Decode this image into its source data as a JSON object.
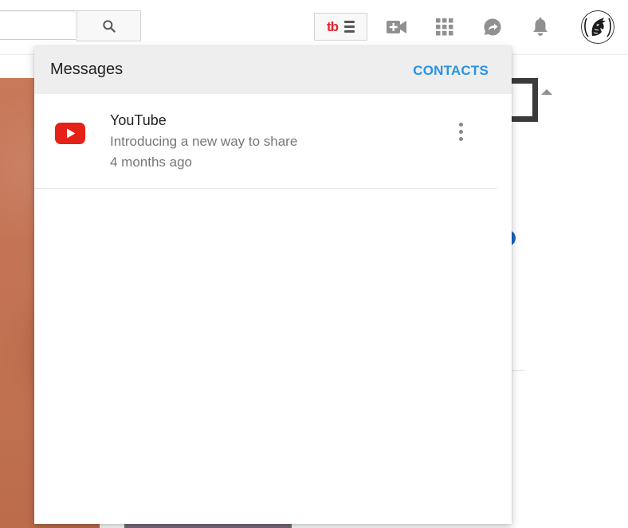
{
  "search": {
    "value": "",
    "placeholder": ""
  },
  "toolbar": {
    "extension_logo_text": "tb",
    "icons": [
      "search-icon",
      "hamburger-icon",
      "video-camera-plus-icon",
      "apps-grid-icon",
      "share-arrow-icon",
      "bell-icon"
    ]
  },
  "messages": {
    "title": "Messages",
    "contacts_label": "CONTACTS",
    "items": [
      {
        "sender": "YouTube",
        "preview": "Introducing a new way to share",
        "time": "4 months ago",
        "icon": "youtube-logo-icon"
      }
    ]
  },
  "colors": {
    "accent": "#2793e6",
    "youtube_red": "#e62117",
    "header_bg": "#eeeeee",
    "tubebuddy_red": "#e8232d"
  }
}
